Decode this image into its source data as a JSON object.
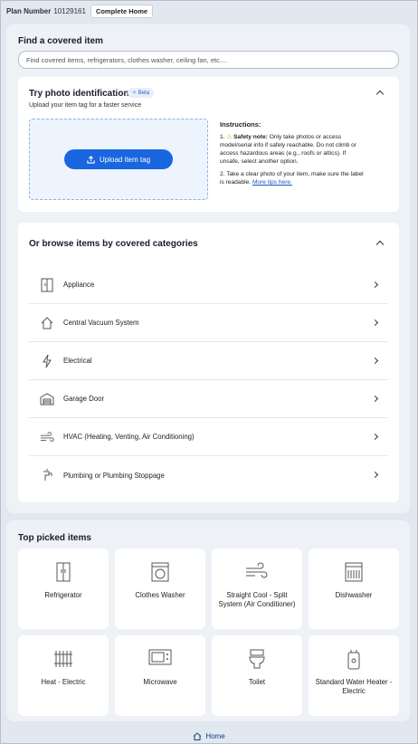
{
  "topbar": {
    "plan_label": "Plan Number",
    "plan_number": "10129161",
    "plan_badge": "Complete Home"
  },
  "find": {
    "title": "Find a covered item",
    "search_placeholder": "Find covered items, refrigerators, clothes washer, ceiling fan, etc...."
  },
  "photo": {
    "title": "Try photo identification",
    "badge": "Beta",
    "subtitle": "Upload your item tag for a faster service",
    "upload_label": "Upload item tag",
    "instructions_title": "Instructions:",
    "instr1_num": "1.",
    "instr1_bold": "Safety note:",
    "instr1_text": "Only take photos or access model/serial info if safely reachable. Do not climb or access hazardous areas (e.g., roofs or attics). If unsafe, select another option.",
    "instr2_num": "2.",
    "instr2_text": "Take a clear photo of your item, make sure the label is readable.",
    "instr2_link": "More tips here."
  },
  "browse": {
    "title": "Or browse items by covered categories",
    "categories": [
      {
        "label": "Appliance",
        "icon": "fridge-icon"
      },
      {
        "label": "Central Vacuum System",
        "icon": "house-icon"
      },
      {
        "label": "Electrical",
        "icon": "bolt-icon"
      },
      {
        "label": "Garage Door",
        "icon": "garage-icon"
      },
      {
        "label": "HVAC (Heating, Venting, Air Conditioning)",
        "icon": "wind-icon"
      },
      {
        "label": "Plumbing or Plumbing Stoppage",
        "icon": "faucet-icon"
      }
    ]
  },
  "top_picked": {
    "title": "Top picked items",
    "items": [
      {
        "label": "Refrigerator",
        "icon": "refrigerator-icon"
      },
      {
        "label": "Clothes Washer",
        "icon": "washer-icon"
      },
      {
        "label": "Straight Cool - Split System (Air Conditioner)",
        "icon": "ac-icon"
      },
      {
        "label": "Dishwasher",
        "icon": "dishwasher-icon"
      },
      {
        "label": "Heat - Electric",
        "icon": "heater-icon"
      },
      {
        "label": "Microwave",
        "icon": "microwave-icon"
      },
      {
        "label": "Toilet",
        "icon": "toilet-icon"
      },
      {
        "label": "Standard Water Heater - Electric",
        "icon": "water-heater-icon"
      }
    ]
  },
  "footer": {
    "home_label": "Home"
  }
}
